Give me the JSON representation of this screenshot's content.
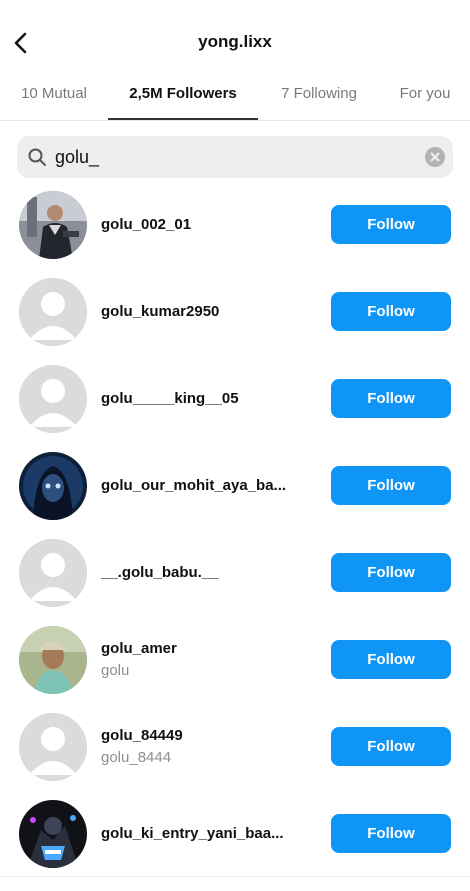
{
  "header": {
    "back_icon": "chevron-left-icon",
    "title": "yong.lixx"
  },
  "tabs": [
    {
      "label": "10 Mutual",
      "active": false
    },
    {
      "label": "2,5M Followers",
      "active": true
    },
    {
      "label": "7 Following",
      "active": false
    },
    {
      "label": "For you",
      "active": false
    }
  ],
  "search": {
    "icon": "search-icon",
    "value": "golu_",
    "clear_icon": "clear-icon"
  },
  "follow_label": "Follow",
  "colors": {
    "accent": "#0f95f6",
    "secondary_text": "#8e8e8e",
    "search_bg": "#eeeeee"
  },
  "users": [
    {
      "username": "golu_002_01",
      "fullname": "",
      "avatar": "photo-man-dark-jacket"
    },
    {
      "username": "golu_kumar2950",
      "fullname": "",
      "avatar": "default-avatar"
    },
    {
      "username": "golu_____king__05",
      "fullname": "",
      "avatar": "default-avatar"
    },
    {
      "username": "golu_our_mohit_aya_ba...",
      "fullname": "",
      "avatar": "photo-hooded-figure-blue"
    },
    {
      "username": "__.golu_babu.__",
      "fullname": "",
      "avatar": "default-avatar"
    },
    {
      "username": "golu_amer",
      "fullname": "golu",
      "avatar": "photo-boy-cap"
    },
    {
      "username": "golu_84449",
      "fullname": "golu_8444",
      "avatar": "default-avatar"
    },
    {
      "username": "golu_ki_entry_yani_baa...",
      "fullname": "",
      "avatar": "photo-gaming-art"
    }
  ]
}
